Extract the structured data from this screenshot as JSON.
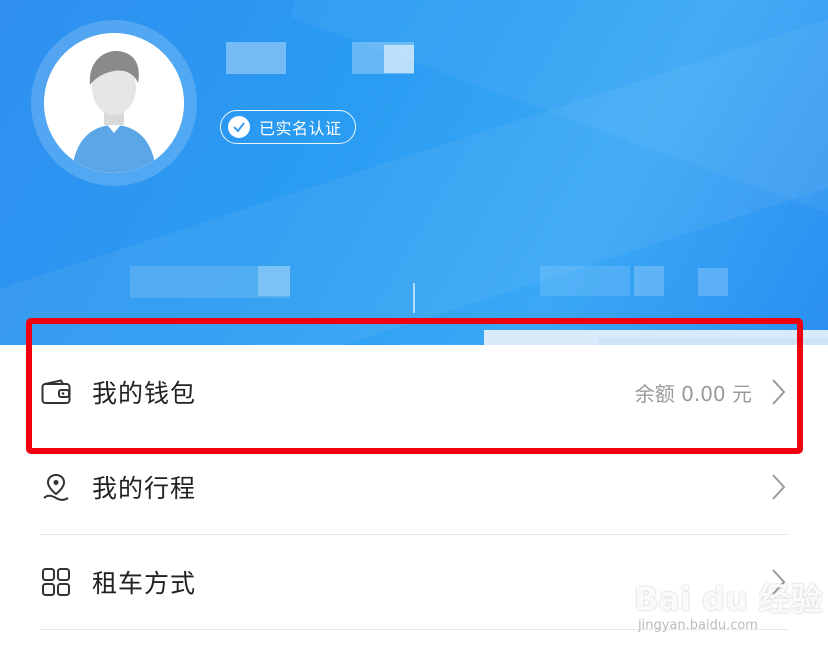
{
  "profile": {
    "verified_badge": "已实名认证"
  },
  "menu": [
    {
      "icon": "wallet-icon",
      "label": "我的钱包",
      "value": "余额 0.00 元"
    },
    {
      "icon": "location-pin-icon",
      "label": "我的行程"
    },
    {
      "icon": "grid-icon",
      "label": "租车方式"
    }
  ],
  "watermark": {
    "brand": "Bai du 经验",
    "url": "jingyan.baidu.com"
  },
  "colors": {
    "header_blue": "#2f8ff0",
    "highlight_red": "#f0000e",
    "label_text": "#222222",
    "muted_text": "#9a9a9a"
  }
}
